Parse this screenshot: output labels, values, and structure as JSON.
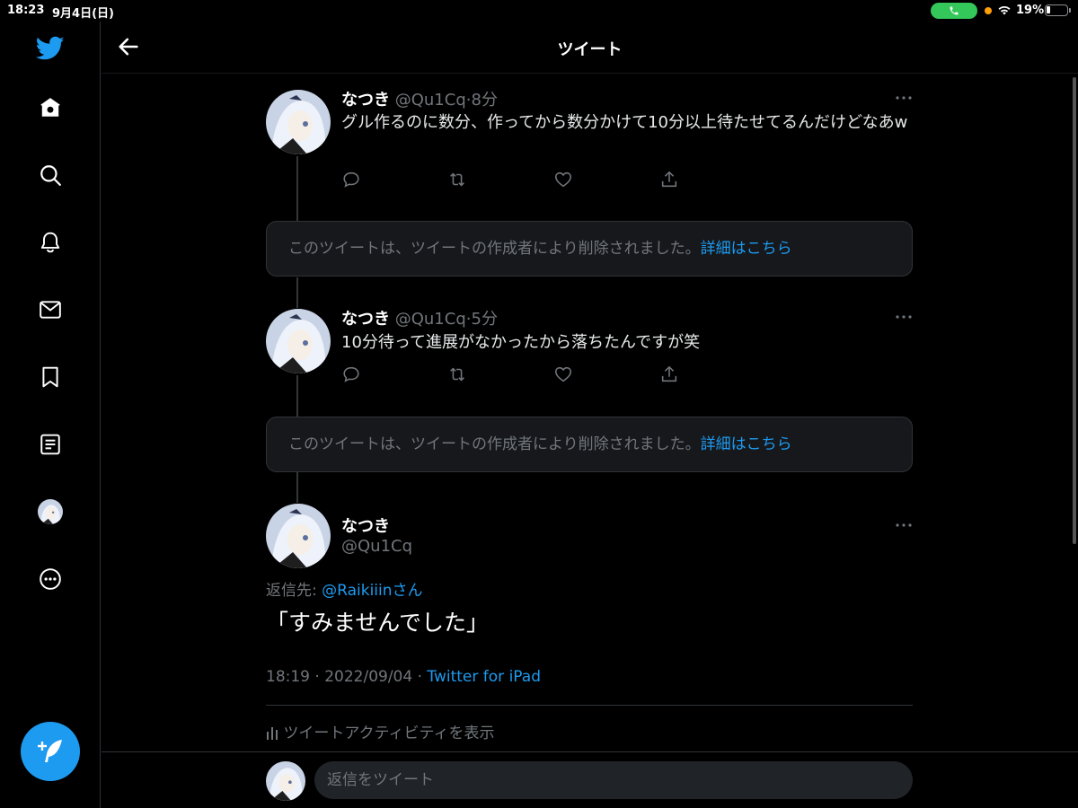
{
  "status_bar": {
    "time": "18:23",
    "date": "9月4日(日)",
    "battery_percent": "19%",
    "battery_level": 0.19
  },
  "sidebar": {
    "items": [
      {
        "name": "home",
        "icon": "home-icon"
      },
      {
        "name": "explore",
        "icon": "search-icon"
      },
      {
        "name": "notifications",
        "icon": "bell-icon"
      },
      {
        "name": "messages",
        "icon": "mail-icon"
      },
      {
        "name": "bookmarks",
        "icon": "bookmark-icon"
      },
      {
        "name": "lists",
        "icon": "list-icon"
      },
      {
        "name": "profile",
        "icon": "avatar"
      },
      {
        "name": "more",
        "icon": "more-icon"
      }
    ],
    "compose_icon": "feather-plus-icon"
  },
  "header": {
    "title": "ツイート"
  },
  "tweets": [
    {
      "name": "なつき",
      "handle": "@Qu1Cq",
      "time": "8分",
      "text": "グル作るのに数分、作ってから数分かけて10分以上待たせてるんだけどなあw"
    },
    {
      "name": "なつき",
      "handle": "@Qu1Cq",
      "time": "5分",
      "text": "10分待って進展がなかったから落ちたんですが笑"
    }
  ],
  "deleted_notice": {
    "text": "このツイートは、ツイートの作成者により削除されました。",
    "link": "詳細はこちら"
  },
  "main_tweet": {
    "name": "なつき",
    "handle": "@Qu1Cq",
    "reply_prefix": "返信先: ",
    "reply_mention": "@Raikiiin",
    "reply_suffix": "さん",
    "text": "「すみませんでした」",
    "timestamp": "18:19 · 2022/09/04 · ",
    "source": "Twitter for iPad",
    "activity": "ツイートアクティビティを表示"
  },
  "reply_bar": {
    "placeholder": "返信をツイート"
  },
  "colors": {
    "accent": "#1d9bf0",
    "background": "#000000",
    "secondary_text": "#71767b"
  }
}
